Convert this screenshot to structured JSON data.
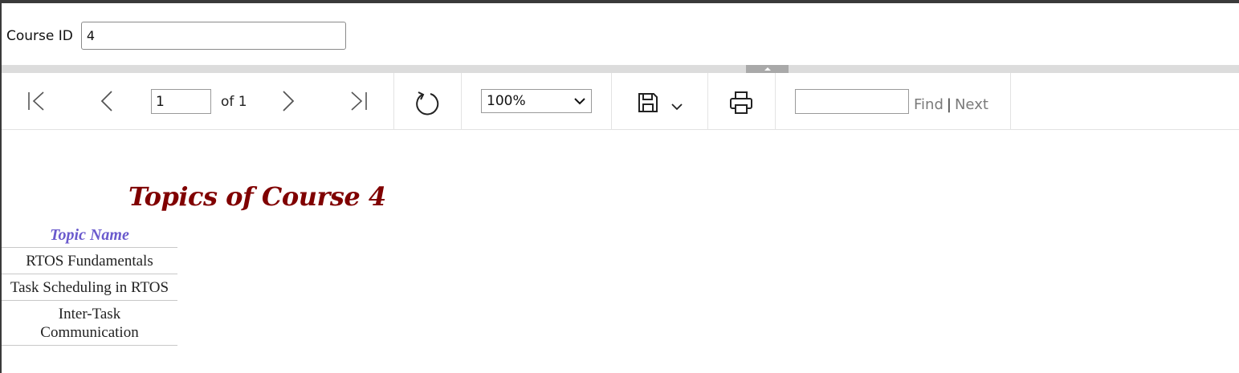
{
  "parameters": {
    "course_id_label": "Course ID",
    "course_id_value": "4"
  },
  "toolbar": {
    "current_page": "1",
    "of_text": "of 1",
    "zoom": "100%",
    "find_label": "Find",
    "find_separator": "|",
    "next_label": "Next",
    "icons": [
      "first-page-icon",
      "previous-page-icon",
      "next-page-icon",
      "last-page-icon",
      "refresh-icon",
      "save-icon",
      "chevron-down-icon",
      "print-icon"
    ]
  },
  "report": {
    "title": "Topics of Course 4",
    "column_header": "Topic Name",
    "rows": [
      "RTOS Fundamentals",
      "Task Scheduling in RTOS",
      "Inter-Task Communication"
    ],
    "colors": {
      "title": "#800000",
      "header": "#6a5acd"
    }
  }
}
